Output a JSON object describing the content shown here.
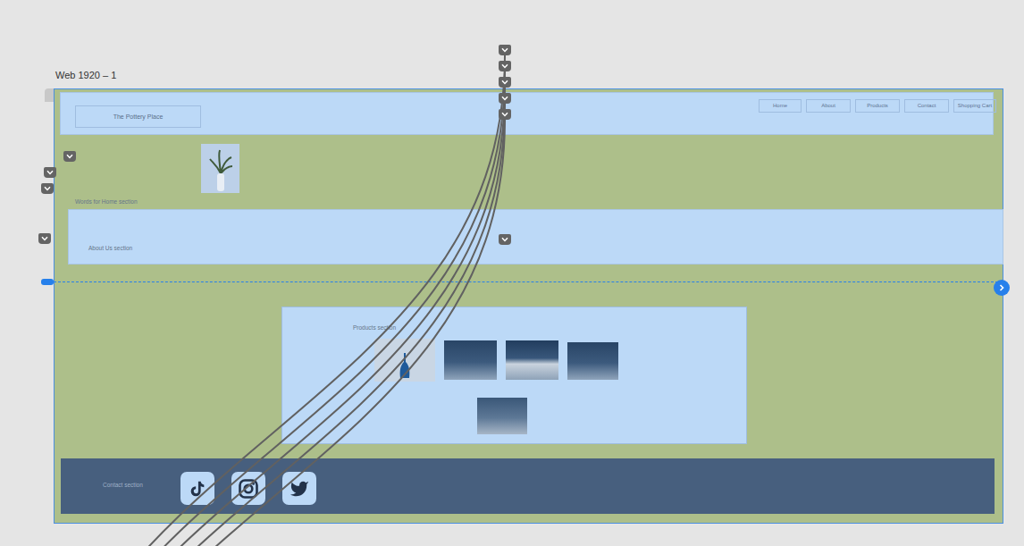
{
  "artboard": {
    "title": "Web 1920 – 1"
  },
  "logo": {
    "text": "The Pottery Place"
  },
  "nav": [
    {
      "label": "Home",
      "target": "Words for Home section"
    },
    {
      "label": "About",
      "target": "About Us section"
    },
    {
      "label": "Products",
      "target": "Products section"
    },
    {
      "label": "Contact",
      "target": "Contact section"
    },
    {
      "label": "Shopping Cart",
      "target": "Products section"
    }
  ],
  "sections": [
    {
      "label": "Words for Home section"
    },
    {
      "label": "About Us section"
    },
    {
      "label": "Products section"
    },
    {
      "label": "Contact section"
    }
  ],
  "social": [
    {
      "kind": "tiktok"
    },
    {
      "kind": "instagram"
    },
    {
      "kind": "twitter"
    }
  ]
}
